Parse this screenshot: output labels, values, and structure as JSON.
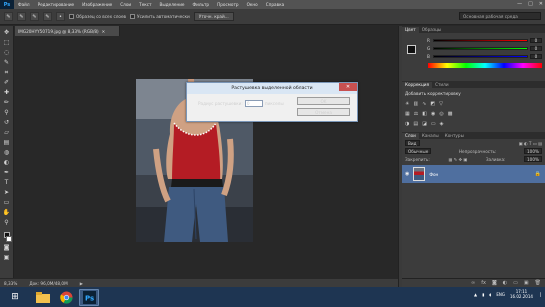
{
  "menubar": {
    "logo": "Ps",
    "items": [
      "Файл",
      "Редактирование",
      "Изображение",
      "Слои",
      "Текст",
      "Выделение",
      "Фильтр",
      "Просмотр",
      "Окно",
      "Справка"
    ],
    "minimize": "—",
    "maximize": "□",
    "close": "✕"
  },
  "options": {
    "sample_all_layers_label": "Образец со всех слоев",
    "auto_enhance_label": "Усилить автоматически",
    "refine_edge_label": "Уточн. край...",
    "workspace_label": "Основная рабочая среда"
  },
  "document": {
    "tab_label": "IMG20HYY50719.jpg @ 8,33% (RGB/8)",
    "zoom": "8,33%",
    "doc_size": "Док: 96,0M/48,0M"
  },
  "dialog": {
    "title": "Растушевка выделенной области",
    "radius_label": "Радиус растушевки:",
    "radius_value": "0",
    "unit_label": "пикселы",
    "ok_label": "OK",
    "cancel_label": "Отмена"
  },
  "color_panel": {
    "tabs": [
      "Цвет",
      "Образцы"
    ],
    "rows": [
      {
        "label": "R",
        "value": "0"
      },
      {
        "label": "G",
        "value": "0"
      },
      {
        "label": "B",
        "value": "0"
      }
    ]
  },
  "adjustments_panel": {
    "tabs": [
      "Коррекция",
      "Стили"
    ],
    "title": "Добавить корректировку"
  },
  "layers_panel": {
    "tabs": [
      "Слои",
      "Каналы",
      "Контуры"
    ],
    "kind_filter": "Вид",
    "blend_mode": "Обычные",
    "opacity_label": "Непрозрачность:",
    "opacity_value": "100%",
    "lock_label": "Закрепить:",
    "fill_label": "Заливка:",
    "fill_value": "100%",
    "layer_name": "Фон"
  },
  "taskbar": {
    "lang": "ENG",
    "time": "17:11",
    "date": "16.02.2014"
  },
  "colors": {
    "accent": "#4f6f9f",
    "dialog_title_bg": "#d9e6f4",
    "close_red": "#c75050"
  }
}
